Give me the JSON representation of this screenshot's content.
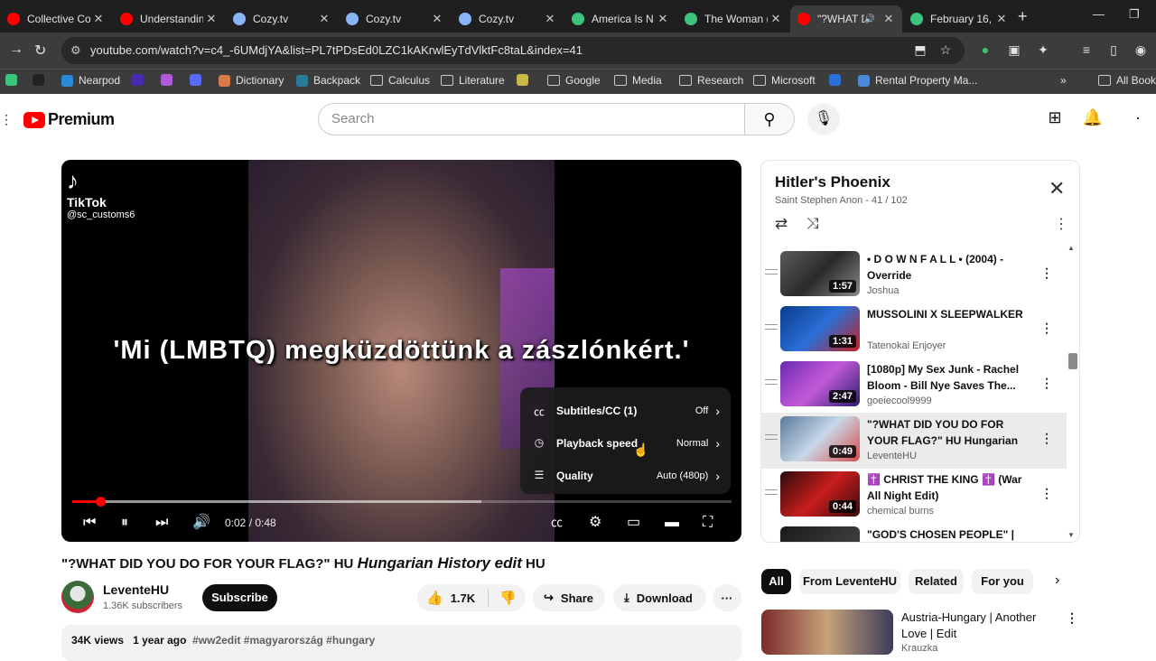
{
  "browser": {
    "tabs": [
      {
        "title": "Collective Co",
        "favicon_color": "#ff0000"
      },
      {
        "title": "Understandin",
        "favicon_color": "#ff0000"
      },
      {
        "title": "Cozy.tv",
        "favicon_color": "#8ab4f8"
      },
      {
        "title": "Cozy.tv",
        "favicon_color": "#8ab4f8"
      },
      {
        "title": "Cozy.tv",
        "favicon_color": "#8ab4f8"
      },
      {
        "title": "America Is N",
        "favicon_color": "#3cc47c"
      },
      {
        "title": "The Woman (",
        "favicon_color": "#3cc47c"
      },
      {
        "title": "\"?WHAT DI",
        "favicon_color": "#ff0000"
      },
      {
        "title": "February 16,",
        "favicon_color": "#3cc47c"
      }
    ],
    "url": "youtube.com/watch?v=c4_-6UMdjYA&list=PL7tPDsEd0LZC1kAKrwlEyTdVlktFc8taL&index=41",
    "bookmarks": [
      {
        "label": "",
        "icon": "green-shield-icon"
      },
      {
        "label": "",
        "icon": "dark-icon"
      },
      {
        "label": "Nearpod",
        "icon": "nearpod-icon"
      },
      {
        "label": "",
        "icon": "purple-icon"
      },
      {
        "label": "",
        "icon": "purple-q-icon"
      },
      {
        "label": "",
        "icon": "blue-ring-icon"
      },
      {
        "label": "Dictionary",
        "icon": "dictionary-icon"
      },
      {
        "label": "Backpack",
        "icon": "backpack-icon"
      },
      {
        "label": "Calculus",
        "icon": "folder-icon"
      },
      {
        "label": "Literature",
        "icon": "folder-icon"
      },
      {
        "label": "",
        "icon": "image-icon"
      },
      {
        "label": "Google",
        "icon": "folder-icon"
      },
      {
        "label": "Media",
        "icon": "folder-icon"
      },
      {
        "label": "Research",
        "icon": "folder-icon"
      },
      {
        "label": "Microsoft",
        "icon": "folder-icon"
      },
      {
        "label": "",
        "icon": "blue-figure-icon"
      },
      {
        "label": "Rental Property Ma...",
        "icon": "shield-icon"
      }
    ],
    "all_bookmarks_label": "All Bookm"
  },
  "youtube": {
    "logo_text": "Premium",
    "search_placeholder": "Search"
  },
  "player": {
    "tiktok_brand": "TikTok",
    "tiktok_handle": "@sc_customs6",
    "caption": "'Mi (LMBTQ) megküzdöttünk a zászlónkért.'",
    "settings": [
      {
        "label": "Subtitles/CC (1)",
        "value": "Off",
        "icon": "cc-icon"
      },
      {
        "label": "Playback speed",
        "value": "Normal",
        "icon": "playback-speed-icon"
      },
      {
        "label": "Quality",
        "value": "Auto (480p)",
        "icon": "quality-sliders-icon"
      }
    ],
    "time_current": "0:02",
    "time_total": "0:48",
    "progress_fraction": 0.042,
    "buffered_fraction": 0.62
  },
  "video": {
    "title_prefix": "\"?WHAT DID YOU DO FOR YOUR FLAG?\" HU",
    "title_italic": "Hungarian History edit",
    "title_suffix": "HU",
    "channel": "LeventeHU",
    "subscribers": "1.36K subscribers",
    "subscribe_label": "Subscribe",
    "likes": "1.7K",
    "share_label": "Share",
    "download_label": "Download",
    "views": "34K views",
    "age": "1 year ago",
    "hashtags": "#ww2edit #magyarország #hungary"
  },
  "playlist": {
    "title": "Hitler's Phoenix",
    "subtitle": "Saint Stephen Anon - 41 / 102",
    "items": [
      {
        "title": "• D O W N F A L L • (2004) - Override",
        "channel": "Joshua",
        "duration": "1:57",
        "thumb": "linear-gradient(135deg,#5a5a5a,#2b2b2b,#8a8a8a)"
      },
      {
        "title": "MUSSOLINI X SLEEPWALKER",
        "channel": "Tatenokai Enjoyer",
        "duration": "1:31",
        "thumb": "linear-gradient(135deg,#0a3c8c,#2a6fd6,#c81e1e)"
      },
      {
        "title": "[1080p] My Sex Junk - Rachel Bloom - Bill Nye Saves The...",
        "channel": "goeiecool9999",
        "duration": "2:47",
        "thumb": "linear-gradient(135deg,#6b2ab0,#c35ad8,#2a1d6b)"
      },
      {
        "title": "\"?WHAT DID YOU DO FOR YOUR FLAG?\" HU Hungarian Histor...",
        "channel": "LeventeHU",
        "duration": "0:49",
        "thumb": "linear-gradient(135deg,#5a7a9a,#c8d8e8,#d84a4a)"
      },
      {
        "title": "✝️ CHRIST THE KING ✝️ (War All Night Edit)",
        "channel": "chemical burns",
        "duration": "0:44",
        "thumb": "linear-gradient(135deg,#2a0a0a,#c81e1e,#3a0a0a)"
      },
      {
        "title": "\"GOD'S CHOSEN PEOPLE\" |",
        "channel": "",
        "duration": "",
        "thumb": "linear-gradient(135deg,#1a1a1a,#4a4a4a)"
      }
    ]
  },
  "chips": [
    "All",
    "From LeventeHU",
    "Related",
    "For you"
  ],
  "recommendation": {
    "title": "Austria-Hungary | Another Love | Edit",
    "channel": "Krauzka"
  }
}
